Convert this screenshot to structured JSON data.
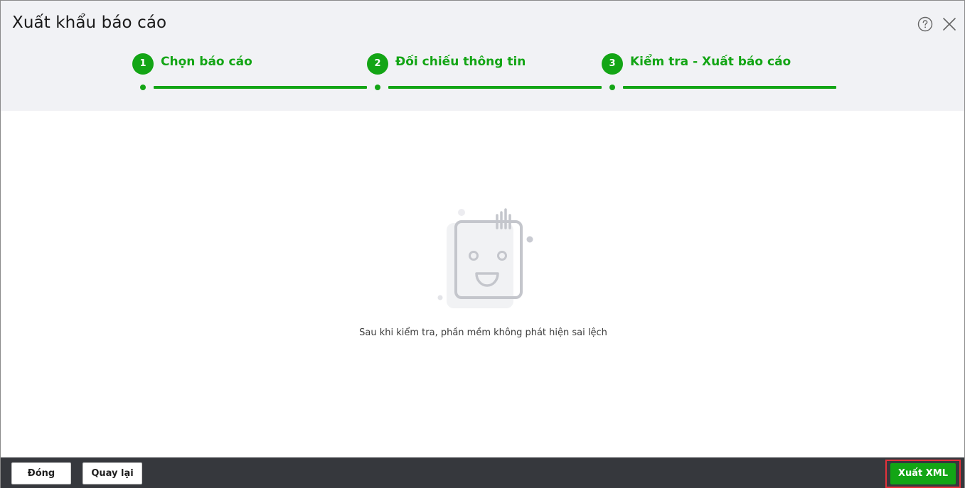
{
  "dialog": {
    "title": "Xuất khẩu báo cáo",
    "help_icon": "help-circle-icon",
    "close_icon": "close-icon"
  },
  "steps": [
    {
      "number": "1",
      "label": "Chọn báo cáo"
    },
    {
      "number": "2",
      "label": "Đối chiếu thông tin"
    },
    {
      "number": "3",
      "label": "Kiểm tra - Xuất báo cáo"
    }
  ],
  "empty_state": {
    "icon": "empty-notebook-face-icon",
    "message": "Sau khi kiểm tra, phần mềm không phát hiện sai lệch"
  },
  "footer": {
    "close_label": "Đóng",
    "back_label": "Quay lại",
    "export_label": "Xuất XML"
  },
  "colors": {
    "accent": "#13a515",
    "header_bg": "#f1f2f5",
    "footer_bg": "#36383d",
    "highlight": "#e5323b"
  }
}
